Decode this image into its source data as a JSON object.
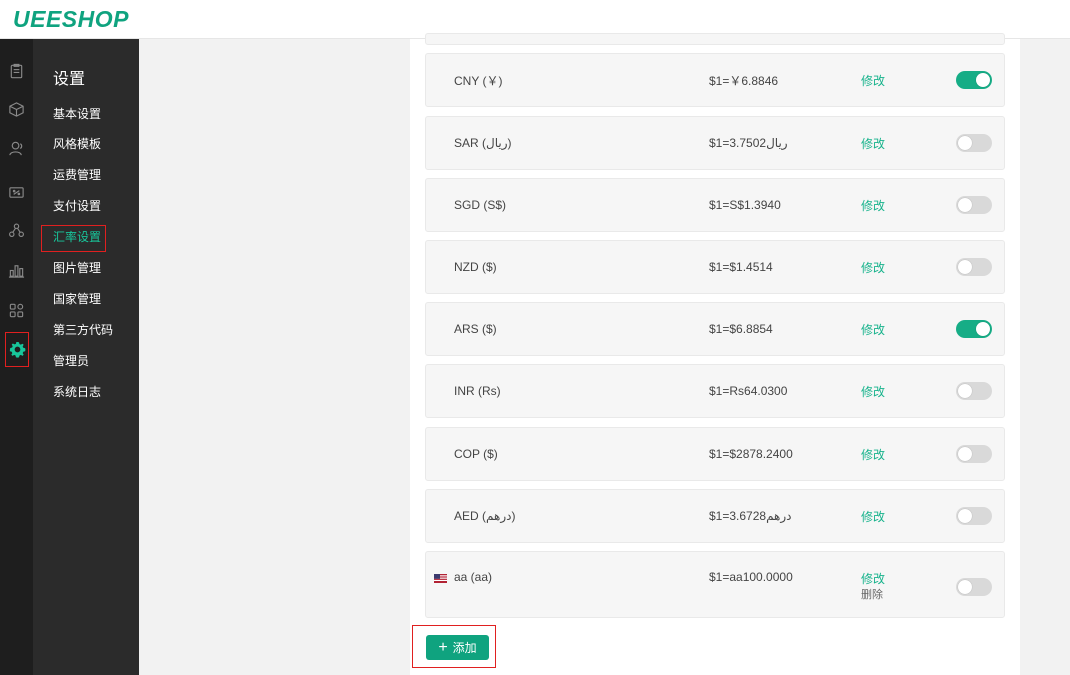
{
  "brand": {
    "logo_text": "UEESHOP",
    "accent_color": "#0fa37f"
  },
  "sidebar_icons": [
    {
      "name": "orders-icon"
    },
    {
      "name": "products-icon"
    },
    {
      "name": "customers-icon"
    },
    {
      "name": "coupons-icon"
    },
    {
      "name": "plugins-icon"
    },
    {
      "name": "statistics-icon"
    },
    {
      "name": "apps-icon"
    },
    {
      "name": "settings-icon",
      "active": true
    }
  ],
  "subnav": {
    "title": "设置",
    "items": [
      {
        "label": "基本设置"
      },
      {
        "label": "风格模板"
      },
      {
        "label": "运费管理"
      },
      {
        "label": "支付设置"
      },
      {
        "label": "汇率设置",
        "active": true
      },
      {
        "label": "图片管理"
      },
      {
        "label": "国家管理"
      },
      {
        "label": "第三方代码"
      },
      {
        "label": "管理员"
      },
      {
        "label": "系统日志"
      }
    ]
  },
  "currencies": [
    {
      "name": "CNY (￥)",
      "rate": "$1=￥6.8846",
      "edit": "修改",
      "enabled": true
    },
    {
      "name": "SAR (ريال)",
      "rate": "$1=3.7502ريال",
      "edit": "修改",
      "enabled": false
    },
    {
      "name": "SGD (S$)",
      "rate": "$1=S$1.3940",
      "edit": "修改",
      "enabled": false
    },
    {
      "name": "NZD ($)",
      "rate": "$1=$1.4514",
      "edit": "修改",
      "enabled": false
    },
    {
      "name": "ARS ($)",
      "rate": "$1=$6.8854",
      "edit": "修改",
      "enabled": true
    },
    {
      "name": "INR (Rs)",
      "rate": "$1=Rs64.0300",
      "edit": "修改",
      "enabled": false
    },
    {
      "name": "COP ($)",
      "rate": "$1=$2878.2400",
      "edit": "修改",
      "enabled": false
    },
    {
      "name": "AED (درهم)",
      "rate": "$1=درهم3.6728",
      "edit": "修改",
      "enabled": false
    },
    {
      "name": "aa (aa)",
      "rate": "$1=aa100.0000",
      "edit": "修改",
      "delete": "删除",
      "enabled": false,
      "flag": "us-flag-icon"
    }
  ],
  "add_button": {
    "label": "添加"
  }
}
